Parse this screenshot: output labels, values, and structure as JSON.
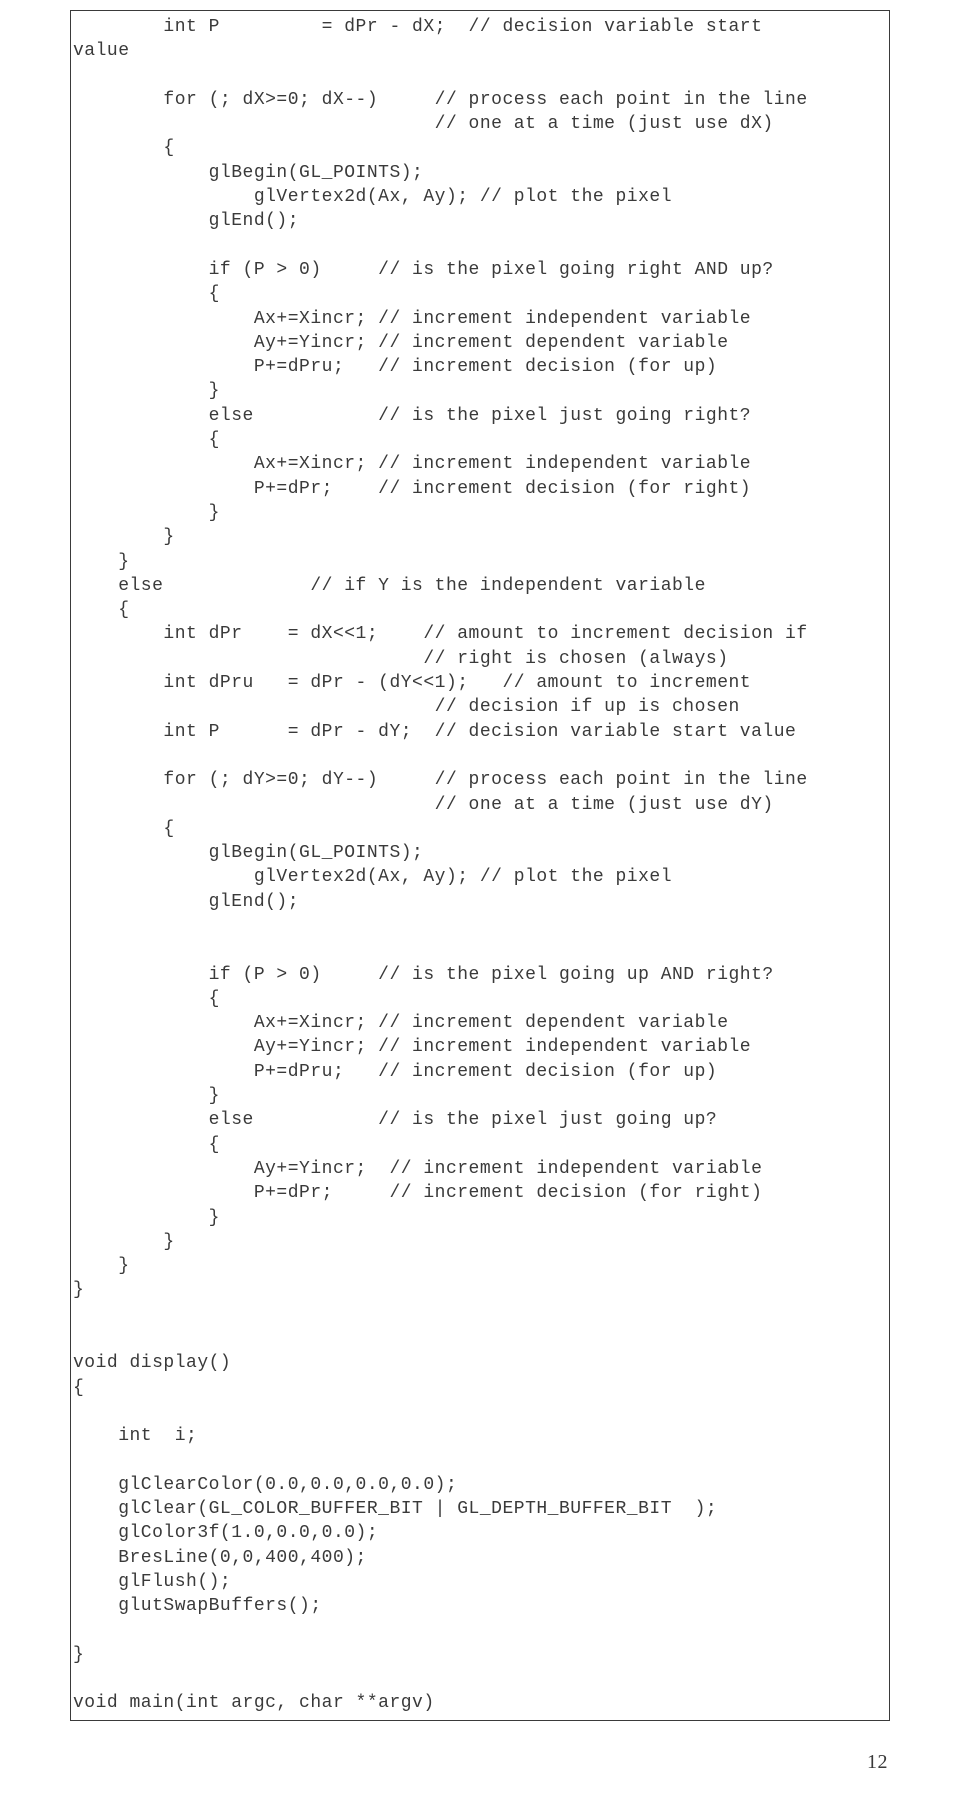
{
  "code": "        int P         = dPr - dX;  // decision variable start \nvalue\n\n        for (; dX>=0; dX--)     // process each point in the line\n                                // one at a time (just use dX)\n        {\n            glBegin(GL_POINTS);\n                glVertex2d(Ax, Ay); // plot the pixel\n            glEnd();\n\n            if (P > 0)     // is the pixel going right AND up?\n            { \n                Ax+=Xincr; // increment independent variable\n                Ay+=Yincr; // increment dependent variable\n                P+=dPru;   // increment decision (for up)\n            }\n            else           // is the pixel just going right?\n            {\n                Ax+=Xincr; // increment independent variable\n                P+=dPr;    // increment decision (for right)\n            }\n        }\n    }\n    else             // if Y is the independent variable\n    {\n        int dPr    = dX<<1;    // amount to increment decision if\n                               // right is chosen (always)\n        int dPru   = dPr - (dY<<1);   // amount to increment \n                                // decision if up is chosen\n        int P      = dPr - dY;  // decision variable start value\n\n        for (; dY>=0; dY--)     // process each point in the line\n                                // one at a time (just use dY)\n        {\n            glBegin(GL_POINTS);\n                glVertex2d(Ax, Ay); // plot the pixel\n            glEnd();\n\n\n            if (P > 0)     // is the pixel going up AND right?\n            { \n                Ax+=Xincr; // increment dependent variable\n                Ay+=Yincr; // increment independent variable\n                P+=dPru;   // increment decision (for up)\n            }\n            else           // is the pixel just going up?\n            {\n                Ay+=Yincr;  // increment independent variable\n                P+=dPr;     // increment decision (for right)\n            }\n        }\n    }\n}\n\n\nvoid display()\n{\n\n    int  i;\n\n    glClearColor(0.0,0.0,0.0,0.0);\n    glClear(GL_COLOR_BUFFER_BIT | GL_DEPTH_BUFFER_BIT  );\n    glColor3f(1.0,0.0,0.0);\n    BresLine(0,0,400,400);\n    glFlush();\n    glutSwapBuffers();\n\n}\n\nvoid main(int argc, char **argv)",
  "pagenum": "12"
}
